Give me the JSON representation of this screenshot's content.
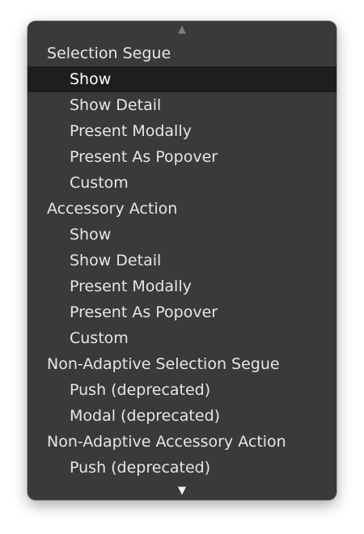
{
  "menu": {
    "scroll_up_icon": "▲",
    "scroll_down_icon": "▼",
    "items": [
      {
        "label": "Selection Segue",
        "kind": "header"
      },
      {
        "label": "Show",
        "kind": "option",
        "selected": true
      },
      {
        "label": "Show Detail",
        "kind": "option"
      },
      {
        "label": "Present Modally",
        "kind": "option"
      },
      {
        "label": "Present As Popover",
        "kind": "option"
      },
      {
        "label": "Custom",
        "kind": "option"
      },
      {
        "label": "Accessory Action",
        "kind": "header"
      },
      {
        "label": "Show",
        "kind": "option"
      },
      {
        "label": "Show Detail",
        "kind": "option"
      },
      {
        "label": "Present Modally",
        "kind": "option"
      },
      {
        "label": "Present As Popover",
        "kind": "option"
      },
      {
        "label": "Custom",
        "kind": "option"
      },
      {
        "label": "Non-Adaptive Selection Segue",
        "kind": "header"
      },
      {
        "label": "Push (deprecated)",
        "kind": "option"
      },
      {
        "label": "Modal (deprecated)",
        "kind": "option"
      },
      {
        "label": "Non-Adaptive Accessory Action",
        "kind": "header"
      },
      {
        "label": "Push (deprecated)",
        "kind": "option"
      }
    ]
  },
  "colors": {
    "menu_background": "#3a3a3c",
    "selected_background": "#1e1e1e",
    "text": "#e6e6e6",
    "selected_text": "#ffffff"
  }
}
